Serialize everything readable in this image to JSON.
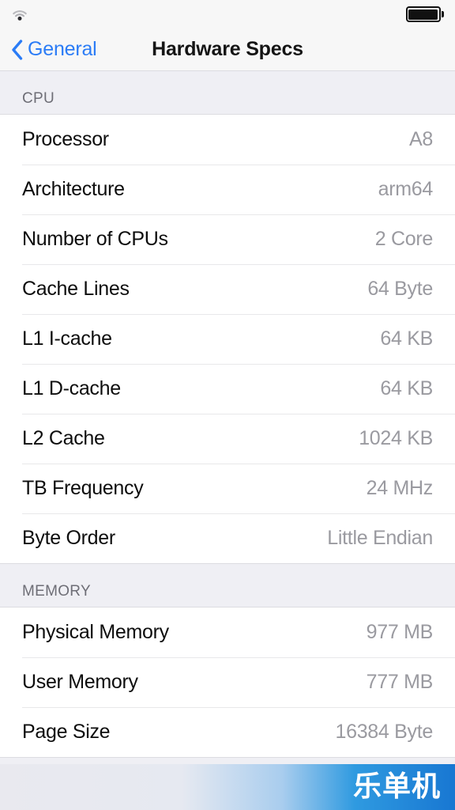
{
  "status_bar": {
    "wifi_icon": "wifi-icon",
    "battery_icon": "battery-full-icon"
  },
  "nav": {
    "back_label": "General",
    "back_icon": "chevron-left-icon",
    "title": "Hardware Specs"
  },
  "sections": [
    {
      "header": "CPU",
      "rows": [
        {
          "label": "Processor",
          "value": "A8"
        },
        {
          "label": "Architecture",
          "value": "arm64"
        },
        {
          "label": "Number of CPUs",
          "value": "2 Core"
        },
        {
          "label": "Cache Lines",
          "value": "64 Byte"
        },
        {
          "label": "L1 I-cache",
          "value": "64 KB"
        },
        {
          "label": "L1 D-cache",
          "value": "64 KB"
        },
        {
          "label": "L2 Cache",
          "value": "1024 KB"
        },
        {
          "label": "TB Frequency",
          "value": "24 MHz"
        },
        {
          "label": "Byte Order",
          "value": "Little Endian"
        }
      ]
    },
    {
      "header": "MEMORY",
      "rows": [
        {
          "label": "Physical Memory",
          "value": "977 MB"
        },
        {
          "label": "User Memory",
          "value": "777 MB"
        },
        {
          "label": "Page Size",
          "value": "16384 Byte"
        }
      ]
    }
  ],
  "watermark": {
    "text": "乐单机"
  },
  "colors": {
    "accent_blue": "#2b7cf6",
    "value_gray": "#9a9aa0",
    "group_background": "#efeff4",
    "bar_background": "#f7f7f7",
    "watermark_blue": "#1877d2"
  }
}
